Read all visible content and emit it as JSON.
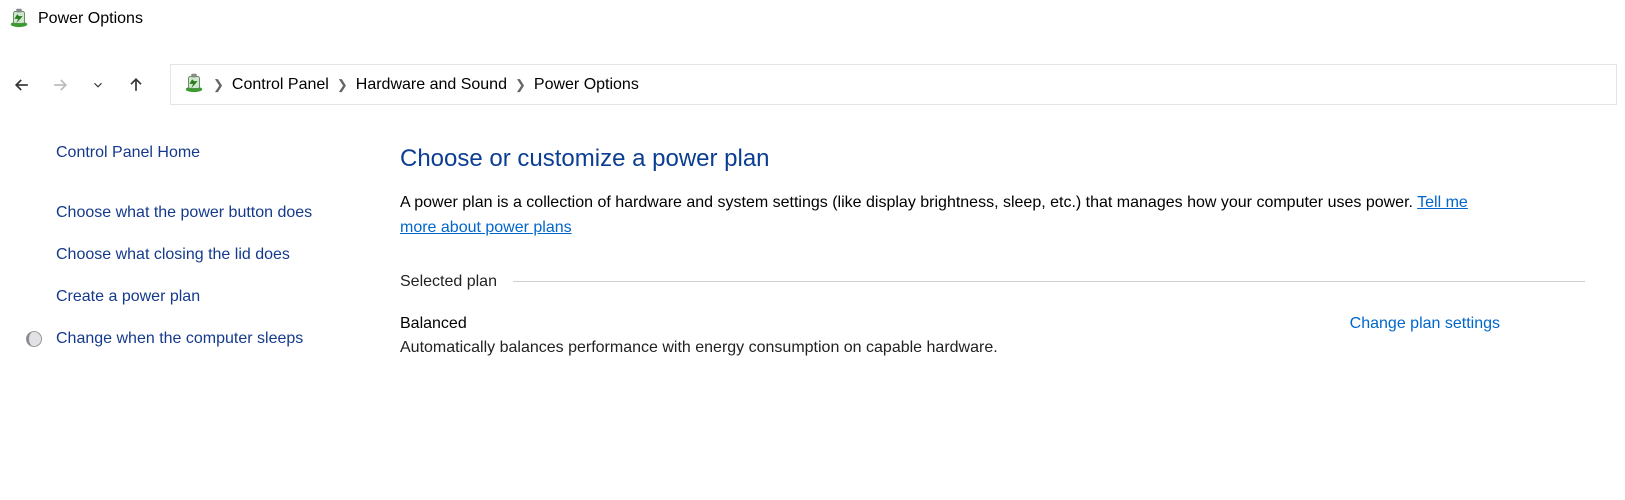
{
  "window": {
    "title": "Power Options"
  },
  "breadcrumb": {
    "items": [
      "Control Panel",
      "Hardware and Sound",
      "Power Options"
    ]
  },
  "sidebar": {
    "home": "Control Panel Home",
    "links": [
      "Choose what the power button does",
      "Choose what closing the lid does",
      "Create a power plan",
      "Change when the computer sleeps"
    ]
  },
  "main": {
    "heading": "Choose or customize a power plan",
    "description_pre": "A power plan is a collection of hardware and system settings (like display brightness, sleep, etc.) that manages how your computer uses power. ",
    "description_link": "Tell me more about power plans",
    "section_label": "Selected plan",
    "plan": {
      "name": "Balanced",
      "desc": "Automatically balances performance with energy consumption on capable hardware.",
      "change_link": "Change plan settings"
    }
  }
}
